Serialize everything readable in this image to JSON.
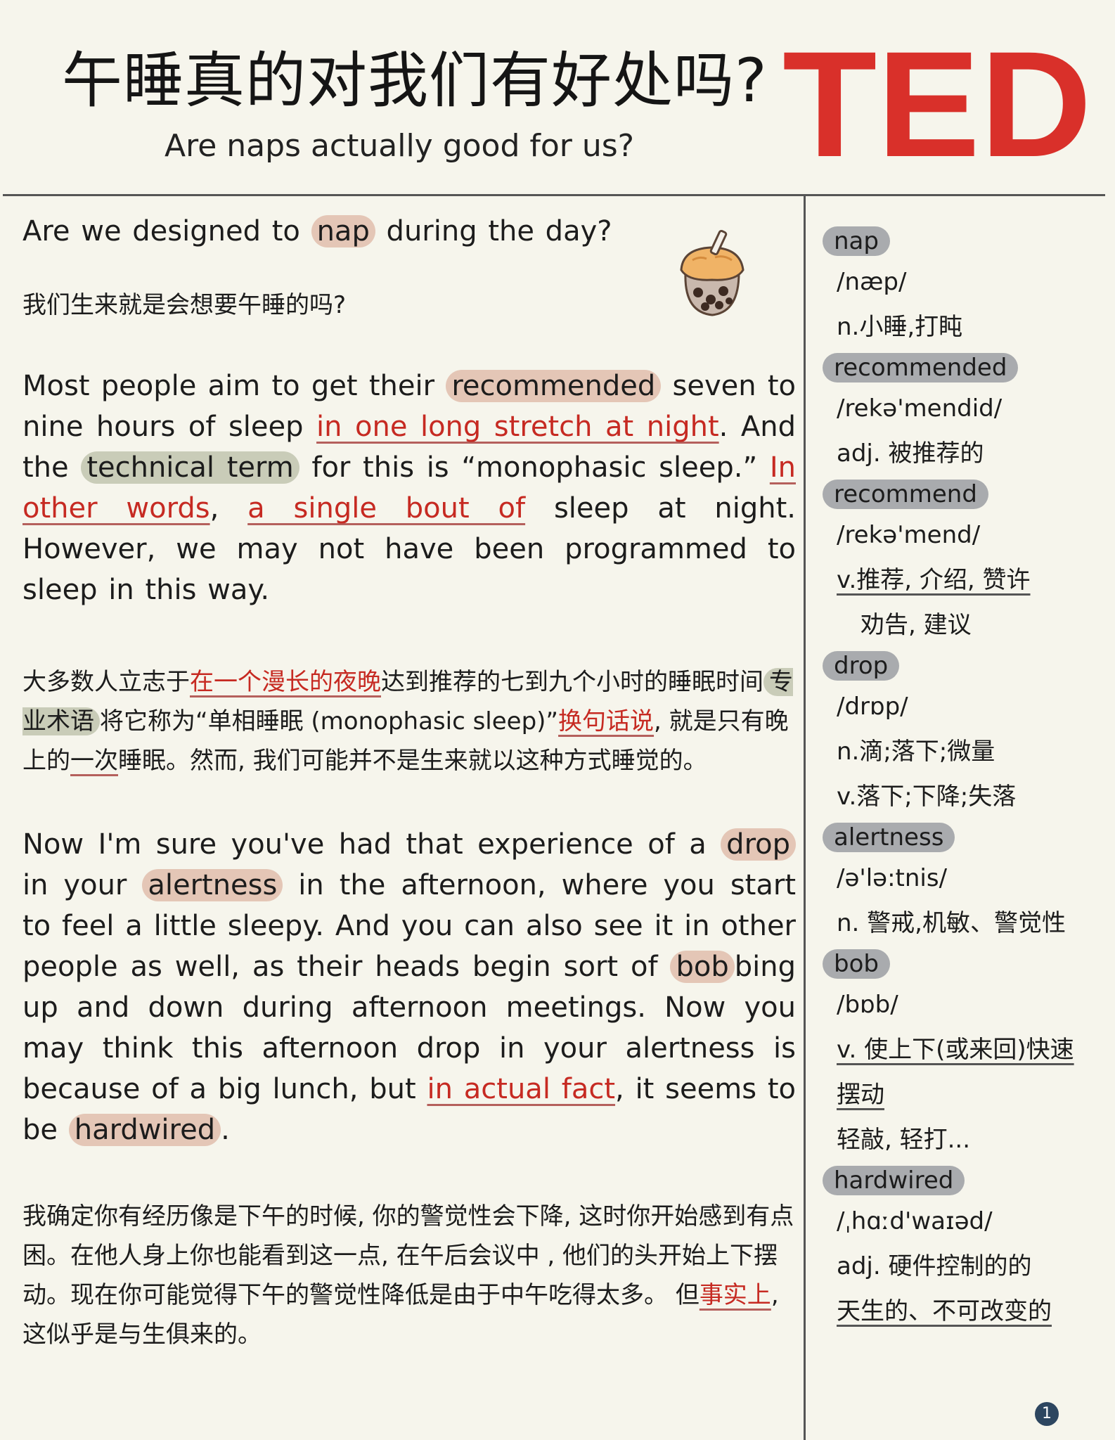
{
  "header": {
    "title_zh": "午睡真的对我们有好处吗?",
    "title_en": "Are naps actually good for us?",
    "logo_text": "TED",
    "logo_color": "#d9302a"
  },
  "main": {
    "question_en": [
      "Are we designed to ",
      "nap",
      " during the day?"
    ],
    "question_zh": "我们生来就是会想要午睡的吗?",
    "para1_en": [
      "Most people aim to get their ",
      "recommended",
      " seven to nine hours of sleep ",
      "in one long stretch at night",
      ". And the ",
      "technical term",
      " for this is “monophasic sleep.” ",
      "In other words",
      ", ",
      "a single bout of",
      " sleep at night. However, we may not have been programmed to sleep in this way."
    ],
    "para1_zh": [
      "大多数人立志于",
      "在一个漫长的夜晚",
      "达到推荐的七到九个小时的睡眠时间",
      "专业术语",
      "将它称为“单相睡眠 (monophasic sleep)”",
      "换句话说",
      ", 就是只有晚上的",
      "一次",
      "睡眠。然而, 我们可能并不是生来就以这种方式睡觉的。"
    ],
    "para2_en": [
      "Now I'm sure you've had that experience of a ",
      "drop",
      " in your ",
      "alertness",
      " in the afternoon, where you start to feel a little sleepy. And you can also see it in other people as well, as their heads begin sort of ",
      "bob",
      "bing up and down during afternoon meetings. Now you may think this afternoon drop in your alertness is because of a big lunch, but ",
      "in actual fact",
      ", it seems to be ",
      "hardwired",
      "."
    ],
    "para2_zh": [
      "我确定你有经历像是下午的时候, 你的警觉性会下降, 这时你开始感到有点困。在他人身上你也能看到这一点, 在午后会议中 , 他们的头开始上下摆动。现在你可能觉得下午的警觉性降低是由于中午吃得太多。 但",
      "事实上",
      ", 这似乎是与生俱来的。"
    ]
  },
  "vocab": [
    {
      "word": "nap",
      "phon": "/næp/",
      "lines": [
        "n.小睡,打盹"
      ]
    },
    {
      "word": "recommended",
      "phon": "/rekə'mendid/",
      "lines": [
        "adj. 被推荐的"
      ]
    },
    {
      "word": "recommend",
      "phon": "/rekə'mend/",
      "lines": [
        "v.推荐, 介绍, 赞许",
        "劝告, 建议"
      ]
    },
    {
      "word": "drop",
      "phon": "/drɒp/",
      "lines": [
        "n.滴;落下;微量",
        "v.落下;下降;失落"
      ]
    },
    {
      "word": "alertness",
      "phon": "/ə'lə:tnis/",
      "lines": [
        "n. 警戒,机敏、警觉性"
      ]
    },
    {
      "word": "bob",
      "phon": "/bɒb/",
      "lines": [
        "v. 使上下(或来回)快速",
        "摆动",
        "轻敲, 轻打..."
      ]
    },
    {
      "word": "hardwired",
      "phon": "/ˌhɑːd'waɪəd/",
      "lines": [
        "adj. 硬件控制的的",
        "天生的、不可改变的"
      ]
    }
  ],
  "page_number": "1",
  "colors": {
    "highlight": "#e4c6b6",
    "highlight_alt": "#c9ccb8",
    "red_phrase": "#c62a22",
    "vocab_pill": "#a9abae",
    "background": "#f6f5ec"
  }
}
